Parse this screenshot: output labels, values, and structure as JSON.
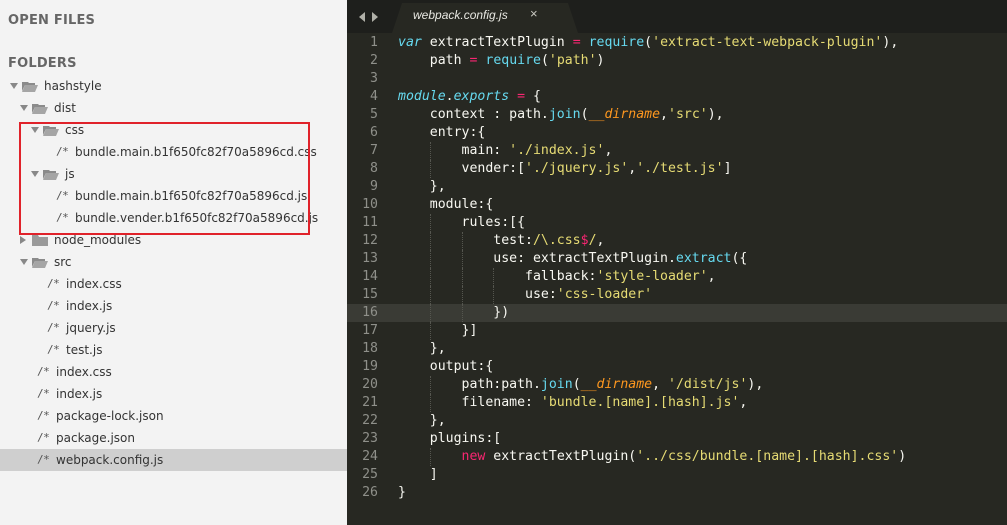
{
  "sidebar": {
    "open_files_heading": "OPEN FILES",
    "folders_heading": "FOLDERS",
    "tree": [
      {
        "label": "hashstyle",
        "type": "folder",
        "depth": 0,
        "expanded": true
      },
      {
        "label": "dist",
        "type": "folder",
        "depth": 1,
        "expanded": true
      },
      {
        "label": "css",
        "type": "folder",
        "depth": 2,
        "expanded": true
      },
      {
        "label": "bundle.main.b1f650fc82f70a5896cd.css",
        "type": "file",
        "depth": 3
      },
      {
        "label": "js",
        "type": "folder",
        "depth": 2,
        "expanded": true
      },
      {
        "label": "bundle.main.b1f650fc82f70a5896cd.js",
        "type": "file",
        "depth": 3
      },
      {
        "label": "bundle.vender.b1f650fc82f70a5896cd.js",
        "type": "file",
        "depth": 3
      },
      {
        "label": "node_modules",
        "type": "folder",
        "depth": 1,
        "expanded": false
      },
      {
        "label": "src",
        "type": "folder",
        "depth": 1,
        "expanded": true
      },
      {
        "label": "index.css",
        "type": "file",
        "depth": 2
      },
      {
        "label": "index.js",
        "type": "file",
        "depth": 2
      },
      {
        "label": "jquery.js",
        "type": "file",
        "depth": 2
      },
      {
        "label": "test.js",
        "type": "file",
        "depth": 2
      },
      {
        "label": "index.css",
        "type": "file",
        "depth": 1
      },
      {
        "label": "index.js",
        "type": "file",
        "depth": 1
      },
      {
        "label": "package-lock.json",
        "type": "file",
        "depth": 1
      },
      {
        "label": "package.json",
        "type": "file",
        "depth": 1
      },
      {
        "label": "webpack.config.js",
        "type": "file",
        "depth": 1,
        "selected": true
      }
    ],
    "file_icon_glyph": "/*",
    "highlight_color": "#e0222a"
  },
  "tabs": [
    {
      "label": "webpack.config.js",
      "active": true,
      "close_glyph": "×"
    }
  ],
  "editor": {
    "theme_colors": {
      "background": "#272822",
      "keyword": "#66d9ef",
      "string": "#e6db74",
      "operator": "#f92672",
      "parameter": "#fd971f",
      "text": "#f8f8f2",
      "line_number": "#8f908a"
    },
    "current_line": 16,
    "lines": [
      {
        "n": "1",
        "tokens": [
          [
            "kw",
            "var"
          ],
          [
            "pl",
            " extractTextPlugin "
          ],
          [
            "op",
            "="
          ],
          [
            "pl",
            " "
          ],
          [
            "fn",
            "require"
          ],
          [
            "pl",
            "("
          ],
          [
            "str",
            "'extract-text-webpack-plugin'"
          ],
          [
            "pl",
            "),"
          ]
        ]
      },
      {
        "n": "2",
        "tokens": [
          [
            "pl",
            "    path "
          ],
          [
            "op",
            "="
          ],
          [
            "pl",
            " "
          ],
          [
            "fn",
            "require"
          ],
          [
            "pl",
            "("
          ],
          [
            "str",
            "'path'"
          ],
          [
            "pl",
            ")"
          ]
        ]
      },
      {
        "n": "3",
        "tokens": []
      },
      {
        "n": "4",
        "tokens": [
          [
            "kw",
            "module"
          ],
          [
            "pl",
            "."
          ],
          [
            "kw",
            "exports"
          ],
          [
            "pl",
            " "
          ],
          [
            "op",
            "="
          ],
          [
            "pl",
            " {"
          ]
        ]
      },
      {
        "n": "5",
        "tokens": [
          [
            "pl",
            "    context : path."
          ],
          [
            "fn",
            "join"
          ],
          [
            "pl",
            "("
          ],
          [
            "var",
            "__dirname"
          ],
          [
            "pl",
            ","
          ],
          [
            "str",
            "'src'"
          ],
          [
            "pl",
            "),"
          ]
        ]
      },
      {
        "n": "6",
        "tokens": [
          [
            "pl",
            "    entry:{"
          ]
        ]
      },
      {
        "n": "7",
        "tokens": [
          [
            "pl",
            "        main: "
          ],
          [
            "str",
            "'./index.js'"
          ],
          [
            "pl",
            ","
          ]
        ]
      },
      {
        "n": "8",
        "tokens": [
          [
            "pl",
            "        vender:["
          ],
          [
            "str",
            "'./jquery.js'"
          ],
          [
            "pl",
            ","
          ],
          [
            "str",
            "'./test.js'"
          ],
          [
            "pl",
            "]"
          ]
        ]
      },
      {
        "n": "9",
        "tokens": [
          [
            "pl",
            "    },"
          ]
        ]
      },
      {
        "n": "10",
        "tokens": [
          [
            "pl",
            "    module:{"
          ]
        ]
      },
      {
        "n": "11",
        "tokens": [
          [
            "pl",
            "        rules:[{"
          ]
        ]
      },
      {
        "n": "12",
        "tokens": [
          [
            "pl",
            "            test:"
          ],
          [
            "str",
            "/\\.css"
          ],
          [
            "op",
            "$"
          ],
          [
            "str",
            "/"
          ],
          [
            "pl",
            ","
          ]
        ]
      },
      {
        "n": "13",
        "tokens": [
          [
            "pl",
            "            use: extractTextPlugin."
          ],
          [
            "fn",
            "extract"
          ],
          [
            "pl",
            "({"
          ]
        ]
      },
      {
        "n": "14",
        "tokens": [
          [
            "pl",
            "                fallback:"
          ],
          [
            "str",
            "'style-loader'"
          ],
          [
            "pl",
            ","
          ]
        ]
      },
      {
        "n": "15",
        "tokens": [
          [
            "pl",
            "                use:"
          ],
          [
            "str",
            "'css-loader'"
          ]
        ]
      },
      {
        "n": "16",
        "tokens": [
          [
            "pl",
            "            })"
          ]
        ]
      },
      {
        "n": "17",
        "tokens": [
          [
            "pl",
            "        }]"
          ]
        ]
      },
      {
        "n": "18",
        "tokens": [
          [
            "pl",
            "    },"
          ]
        ]
      },
      {
        "n": "19",
        "tokens": [
          [
            "pl",
            "    output:{"
          ]
        ]
      },
      {
        "n": "20",
        "tokens": [
          [
            "pl",
            "        path:path."
          ],
          [
            "fn",
            "join"
          ],
          [
            "pl",
            "("
          ],
          [
            "var",
            "__dirname"
          ],
          [
            "pl",
            ", "
          ],
          [
            "str",
            "'/dist/js'"
          ],
          [
            "pl",
            "),"
          ]
        ]
      },
      {
        "n": "21",
        "tokens": [
          [
            "pl",
            "        filename: "
          ],
          [
            "str",
            "'bundle.[name].[hash].js'"
          ],
          [
            "pl",
            ","
          ]
        ]
      },
      {
        "n": "22",
        "tokens": [
          [
            "pl",
            "    },"
          ]
        ]
      },
      {
        "n": "23",
        "tokens": [
          [
            "pl",
            "    plugins:["
          ]
        ]
      },
      {
        "n": "24",
        "tokens": [
          [
            "pl",
            "        "
          ],
          [
            "op",
            "new"
          ],
          [
            "pl",
            " extractTextPlugin("
          ],
          [
            "str",
            "'../css/bundle.[name].[hash].css'"
          ],
          [
            "pl",
            ")"
          ]
        ]
      },
      {
        "n": "25",
        "tokens": [
          [
            "pl",
            "    ]"
          ]
        ]
      },
      {
        "n": "26",
        "tokens": [
          [
            "pl",
            "}"
          ]
        ]
      }
    ]
  }
}
